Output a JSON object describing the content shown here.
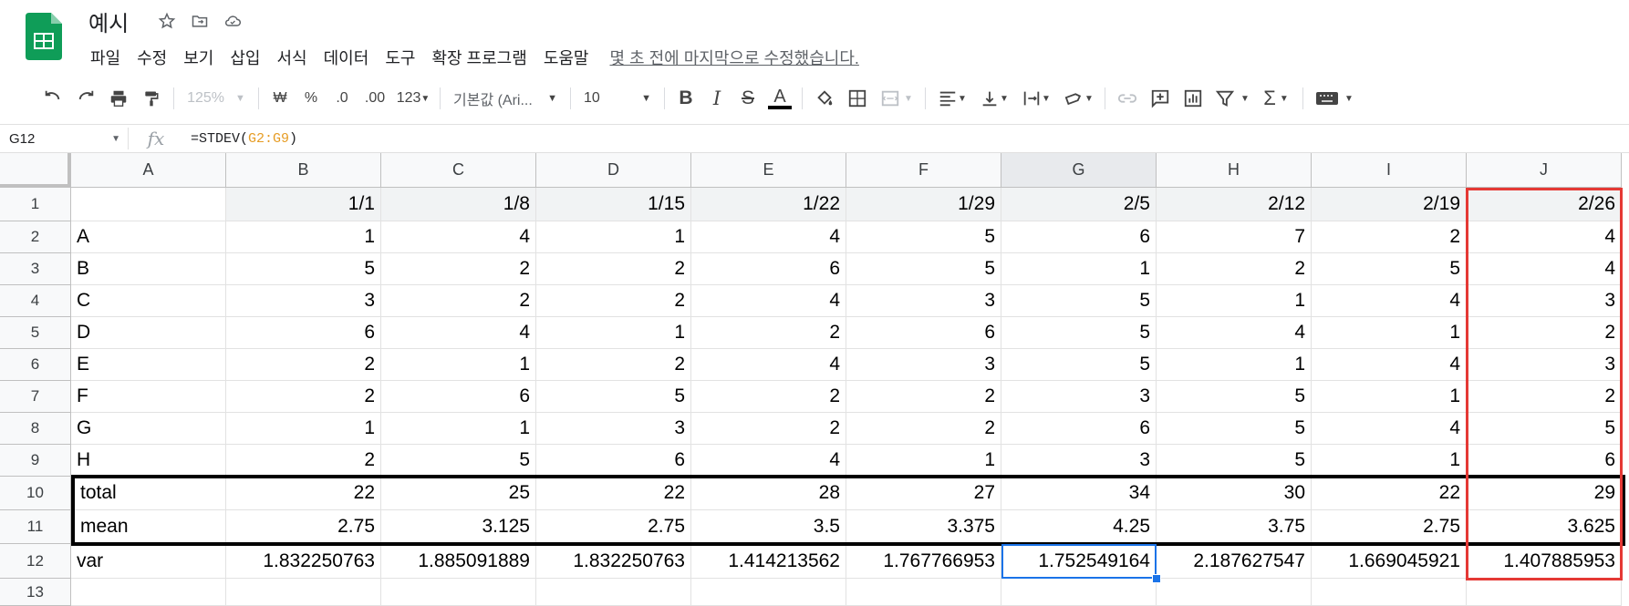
{
  "doc": {
    "title": "예시"
  },
  "menu": [
    "파일",
    "수정",
    "보기",
    "삽입",
    "서식",
    "데이터",
    "도구",
    "확장 프로그램",
    "도움말"
  ],
  "last_edit": "몇 초 전에 마지막으로 수정했습니다.",
  "toolbar": {
    "zoom": "125%",
    "currency": "₩",
    "percent": "%",
    "dec_decrease": ".0",
    "dec_increase": ".00",
    "number_format": "123",
    "font": "기본값 (Ari...",
    "font_size": "10",
    "bold": "B",
    "italic": "I",
    "strike": "S",
    "text_color": "A",
    "sum": "Σ"
  },
  "formula_bar": {
    "name_box": "G12",
    "fx": "fx",
    "formula_prefix": "=STDEV(",
    "formula_range": "G2:G9",
    "formula_suffix": ")"
  },
  "columns": [
    "A",
    "B",
    "C",
    "D",
    "E",
    "F",
    "G",
    "H",
    "I",
    "J"
  ],
  "rows": [
    [
      "",
      "1/1",
      "1/8",
      "1/15",
      "1/22",
      "1/29",
      "2/5",
      "2/12",
      "2/19",
      "2/26"
    ],
    [
      "A",
      "1",
      "4",
      "1",
      "4",
      "5",
      "6",
      "7",
      "2",
      "4"
    ],
    [
      "B",
      "5",
      "2",
      "2",
      "6",
      "5",
      "1",
      "2",
      "5",
      "4"
    ],
    [
      "C",
      "3",
      "2",
      "2",
      "4",
      "3",
      "5",
      "1",
      "4",
      "3"
    ],
    [
      "D",
      "6",
      "4",
      "1",
      "2",
      "6",
      "5",
      "4",
      "1",
      "2"
    ],
    [
      "E",
      "2",
      "1",
      "2",
      "4",
      "3",
      "5",
      "1",
      "4",
      "3"
    ],
    [
      "F",
      "2",
      "6",
      "5",
      "2",
      "2",
      "3",
      "5",
      "1",
      "2"
    ],
    [
      "G",
      "1",
      "1",
      "3",
      "2",
      "2",
      "6",
      "5",
      "4",
      "5"
    ],
    [
      "H",
      "2",
      "5",
      "6",
      "4",
      "1",
      "3",
      "5",
      "1",
      "6"
    ],
    [
      "total",
      "22",
      "25",
      "22",
      "28",
      "27",
      "34",
      "30",
      "22",
      "29"
    ],
    [
      "mean",
      "2.75",
      "3.125",
      "2.75",
      "3.5",
      "3.375",
      "4.25",
      "3.75",
      "2.75",
      "3.625"
    ],
    [
      "var",
      "1.832250763",
      "1.885091889",
      "1.832250763",
      "1.414213562",
      "1.767766953",
      "1.752549164",
      "2.187627547",
      "1.669045921",
      "1.407885953"
    ],
    [
      "",
      "",
      "",
      "",
      "",
      "",
      "",
      "",
      "",
      ""
    ]
  ],
  "row_numbers": [
    "1",
    "2",
    "3",
    "4",
    "5",
    "6",
    "7",
    "8",
    "9",
    "10",
    "11",
    "12",
    "13"
  ],
  "selected_cell": "G12"
}
